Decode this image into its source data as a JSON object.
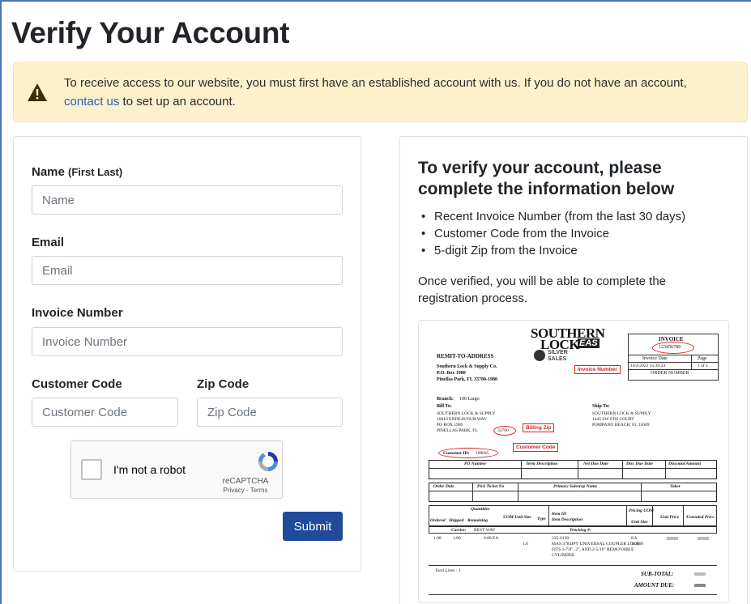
{
  "page": {
    "title": "Verify Your Account"
  },
  "alert": {
    "text_before": "To receive access to our website, you must first have an established account with us. If you do not have an account,",
    "link": "contact us",
    "text_after": " to set up an account."
  },
  "form": {
    "name_label": "Name",
    "name_hint": "(First Last)",
    "name_placeholder": "Name",
    "email_label": "Email",
    "email_placeholder": "Email",
    "invoice_label": "Invoice Number",
    "invoice_placeholder": "Invoice Number",
    "customer_label": "Customer Code",
    "customer_placeholder": "Customer Code",
    "zip_label": "Zip Code",
    "zip_placeholder": "Zip Code",
    "captcha_label": "I'm not a robot",
    "captcha_brand": "reCAPTCHA",
    "captcha_links": "Privacy - Terms",
    "submit_label": "Submit"
  },
  "info": {
    "title": "To verify your account, please complete the information below",
    "requirements": [
      "Recent Invoice Number (from the last 30 days)",
      "Customer Code from the Invoice",
      "5-digit Zip from the Invoice"
    ],
    "paragraph": "Once verified, you will be able to complete the registration process."
  },
  "invoice_sample": {
    "logo_line1": "SOUTHERN",
    "logo_line2": "LOCK",
    "logo_eas": "EAS",
    "logo_silver": "SILVER",
    "logo_sales": "SALES",
    "remit_heading": "REMIT-TO-ADDRESS",
    "remit_line1": "Southern Lock & Supply Co.",
    "remit_line2": "P.O. Box 1980",
    "remit_line3": "Pinellas Park, FL 33780-1980",
    "invoice_heading": "INVOICE",
    "invoice_number": "123456789",
    "invoice_date_label": "Invoice Date",
    "page_label": "Page",
    "invoice_date": "10/4/2022 15:39:24",
    "page_value": "1 of 1",
    "order_number_label": "ORDER NUMBER",
    "branch_label": "Branch:",
    "branch_value": "100 Largo",
    "bill_to_label": "Bill To:",
    "bill_lines": [
      "SOUTHERN LOCK & SUPPLY",
      "10910 ENDEAVOUR WAY",
      "PO BOX 1980",
      "PINELLAS PARK, FL"
    ],
    "bill_zip": "33780",
    "ship_to_label": "Ship To:",
    "ship_lines": [
      "SOUTHERN LOCK & SUPPLY",
      "1445 SW 6TH COURT",
      "POMPANO BEACH, FL 33069"
    ],
    "customer_id_label": "Customer ID:",
    "customer_id_value": "100045",
    "callout_invoice": "Invoice Number",
    "callout_zip": "Billing Zip",
    "callout_customer": "Customer Code",
    "table_headers_1": [
      "PO Number",
      "Term Description",
      "Net Due Date",
      "Disc Due Date",
      "Discount Amount"
    ],
    "table_headers_2": [
      "Order Date",
      "Pick Ticket No",
      "Primary Salesrep Name",
      "Taker"
    ],
    "quantities_label": "Quantities",
    "qty_cols": [
      "Ordered",
      "Shipped",
      "Remaining",
      "UOM Unit Size",
      "Type"
    ],
    "item_id_label": "Item ID",
    "item_desc_label": "Item Description",
    "pricing_uom": "Pricing UOM",
    "unit_size": "Unit Size",
    "unit_price": "Unit Price",
    "extended_price": "Extended Price",
    "carrier_label": "Carrier:",
    "carrier_value": "BEST WAY",
    "tracking_label": "Tracking #:",
    "line_qty": "1.00",
    "line_shipped": "1.00",
    "line_remaining": "0.00 EA",
    "line_type": "1.0",
    "line_item_id": "335-0130",
    "line_desc1": "MAS 3784JPY UNIVERSAL COUPLER LOCK",
    "line_desc2": "FITS 1-7/8\", 2\", AND 2-5/16\" REMOVABLE",
    "line_desc3": "CYLINDER",
    "line_uom": "EA",
    "line_unit_size": "1.0000",
    "total_lines_label": "Total Lines : 1",
    "subtotal_label": "SUB-TOTAL:",
    "amount_due_label": "AMOUNT DUE:"
  },
  "colors": {
    "alert_bg": "#fdf1cc",
    "link": "#1e62c4",
    "submit_bg": "#1f4b9a",
    "callout_red": "#d62222"
  }
}
